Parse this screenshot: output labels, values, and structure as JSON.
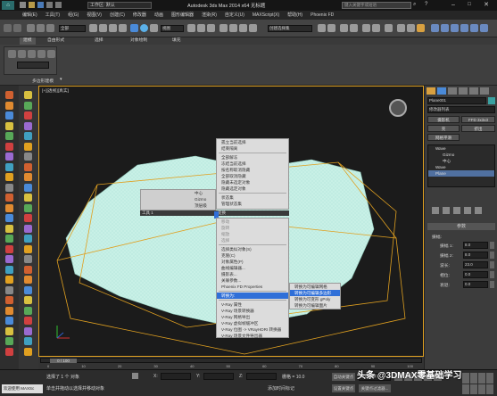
{
  "window": {
    "title": "Autodesk 3ds Max  2014 x64    无标题",
    "workspace_label": "工作区: 默认",
    "search_placeholder": "键入关键字或短语"
  },
  "menubar": [
    "编辑(E)",
    "工具(T)",
    "组(G)",
    "视图(V)",
    "创建(C)",
    "修改器",
    "动画",
    "图形编辑器",
    "渲染(R)",
    "自定义(U)",
    "MAXScript(X)",
    "帮助(H)",
    "Phoenix FD"
  ],
  "toolbar": {
    "selection_filter": "全部",
    "view_dropdown": "视图",
    "named_selection": "创建选择集"
  },
  "ribbon": {
    "tabs": [
      "建模",
      "自由形式",
      "选择",
      "对象绘制",
      "填充"
    ],
    "panel_label": "多边形建模"
  },
  "viewport": {
    "label": "[+][透视][真实]"
  },
  "quad_menu": {
    "left_items": [
      "中心",
      "Gizmo",
      "顶层级"
    ],
    "right_items": [
      "孤立当前选择",
      "结束隔离",
      "全部解冻",
      "冻结当前选择",
      "按名称取消隐藏",
      "全部取消隐藏",
      "隐藏未选定对象",
      "隐藏选定对象",
      "状态集",
      "管理状态集"
    ],
    "lower_items": [
      "移动",
      "旋转",
      "缩放",
      "选择",
      "选择类似对象(S)",
      "克隆(C)",
      "对象属性(P)",
      "曲线编辑器...",
      "摄影表...",
      "关联参数...",
      "转换为:",
      "V-Ray 属性",
      "V-Ray 场景转换器",
      "V-Ray 网格导出",
      "V-Ray 虚拟帧缓冲区",
      "V-Ray 位图 -> VRayHDRI 转换器",
      "V-Ray 场景文件导出器"
    ],
    "header_left": "工具 1",
    "header_right": "变换",
    "lower_extra": [
      "Phoenix FD Properties"
    ],
    "submenu": [
      "转换为可编辑网格",
      "转换为可编辑多边形",
      "转换为可变形 gPoly",
      "转换为可编辑面片"
    ]
  },
  "command_panel": {
    "object_name": "Plane001",
    "modifier_list": "修改器列表",
    "buttons": [
      "摄影机",
      "FFD 3x3x3",
      "壳",
      "挤出",
      "网格平滑"
    ],
    "stack": [
      "Wave",
      "Gizmo",
      "中心",
      "Wave",
      "Plane"
    ],
    "params_title": "参数",
    "params": [
      {
        "label": "振幅 1:",
        "value": "8.0"
      },
      {
        "label": "振幅 2:",
        "value": "8.0"
      },
      {
        "label": "波长:",
        "value": "23.0"
      },
      {
        "label": "相位:",
        "value": "0.0"
      },
      {
        "label": "衰退:",
        "value": "0.0"
      }
    ],
    "params_group": "振幅:"
  },
  "timeline": {
    "frame": "0 / 100",
    "ticks": [
      "0",
      "10",
      "20",
      "30",
      "40",
      "50",
      "60",
      "70",
      "80",
      "90",
      "100"
    ]
  },
  "status": {
    "welcome": "欢迎使用 MAXSc",
    "selected": "选择了 1 个 对象",
    "prompt": "单击并拖动以选择并移动对象",
    "x_label": "X:",
    "y_label": "Y:",
    "z_label": "Z:",
    "grid": "栅格 = 10.0",
    "auto_key": "自动关键点",
    "selected_obj": "选定对象",
    "add_time_tag": "添加时间标记",
    "set_key": "设置关键点",
    "key_filter": "关键点过滤器..."
  },
  "watermark": "头条 @3DMAX零基础学习"
}
